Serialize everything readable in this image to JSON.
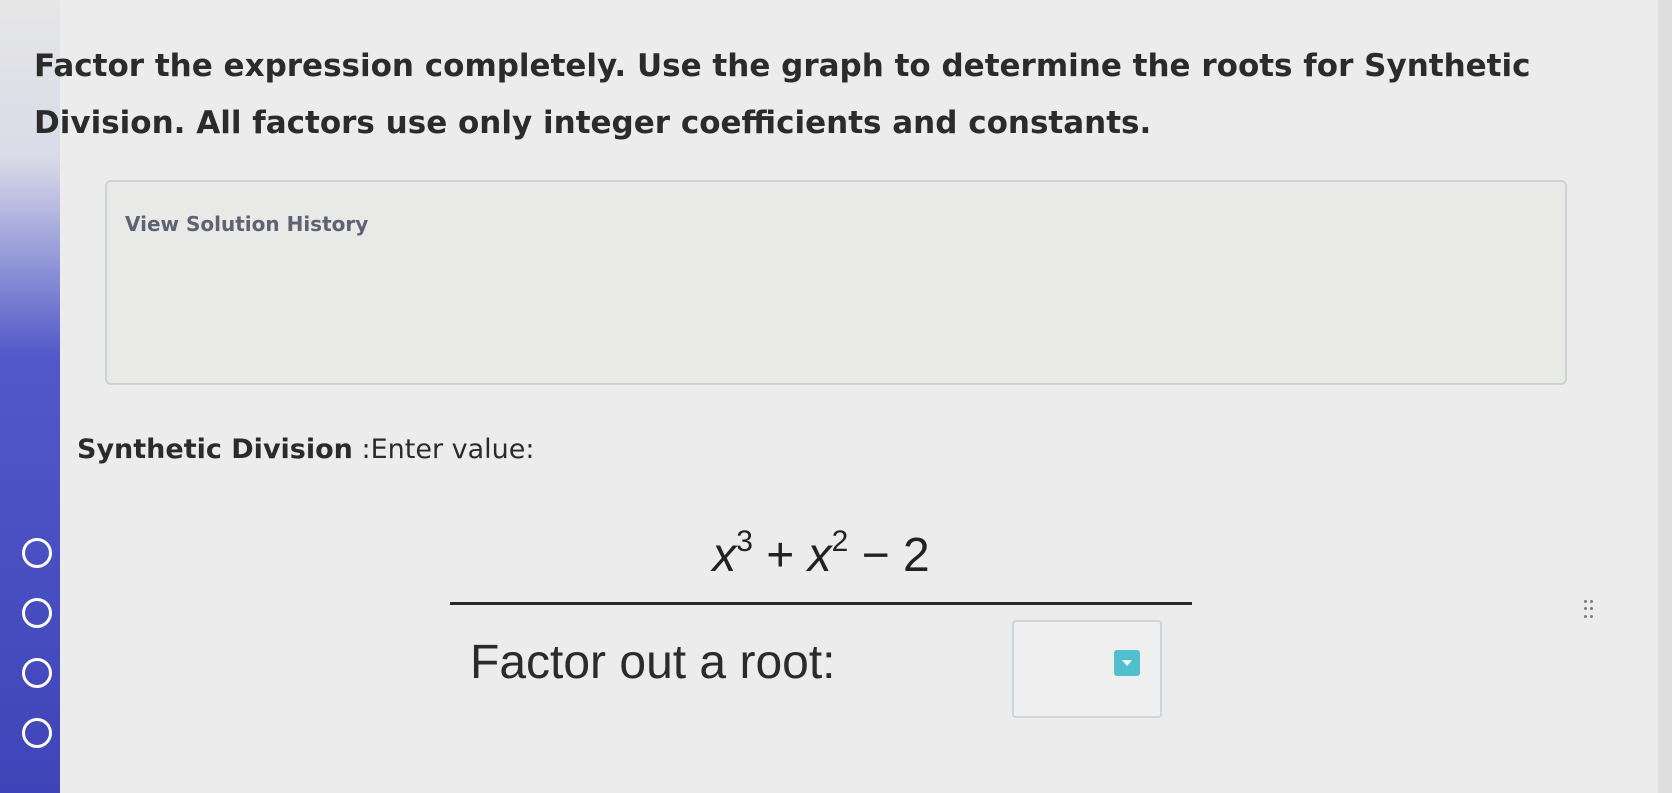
{
  "question": {
    "line1": "Factor the expression completely. Use the graph to determine the roots for Synthetic",
    "line2": "Division. All factors use only integer coefficients and constants."
  },
  "solution_history": {
    "link_label": "View Solution History"
  },
  "synthetic_division": {
    "label_bold": "Synthetic Division",
    "label_rest": " :Enter value:"
  },
  "expression": {
    "var1": "x",
    "exp1": "3",
    "op1": " + ",
    "var2": "x",
    "exp2": "2",
    "op2": " − 2"
  },
  "factor_prompt": "Factor out a root:",
  "root_input": {
    "value": "",
    "dropdown_icon": "caret-down-icon"
  },
  "icons": {
    "steps": "step-circle-icon",
    "drag": "drag-handle-icon"
  },
  "colors": {
    "accent": "#4fc0cc",
    "sidebar": "#3f45b8"
  }
}
